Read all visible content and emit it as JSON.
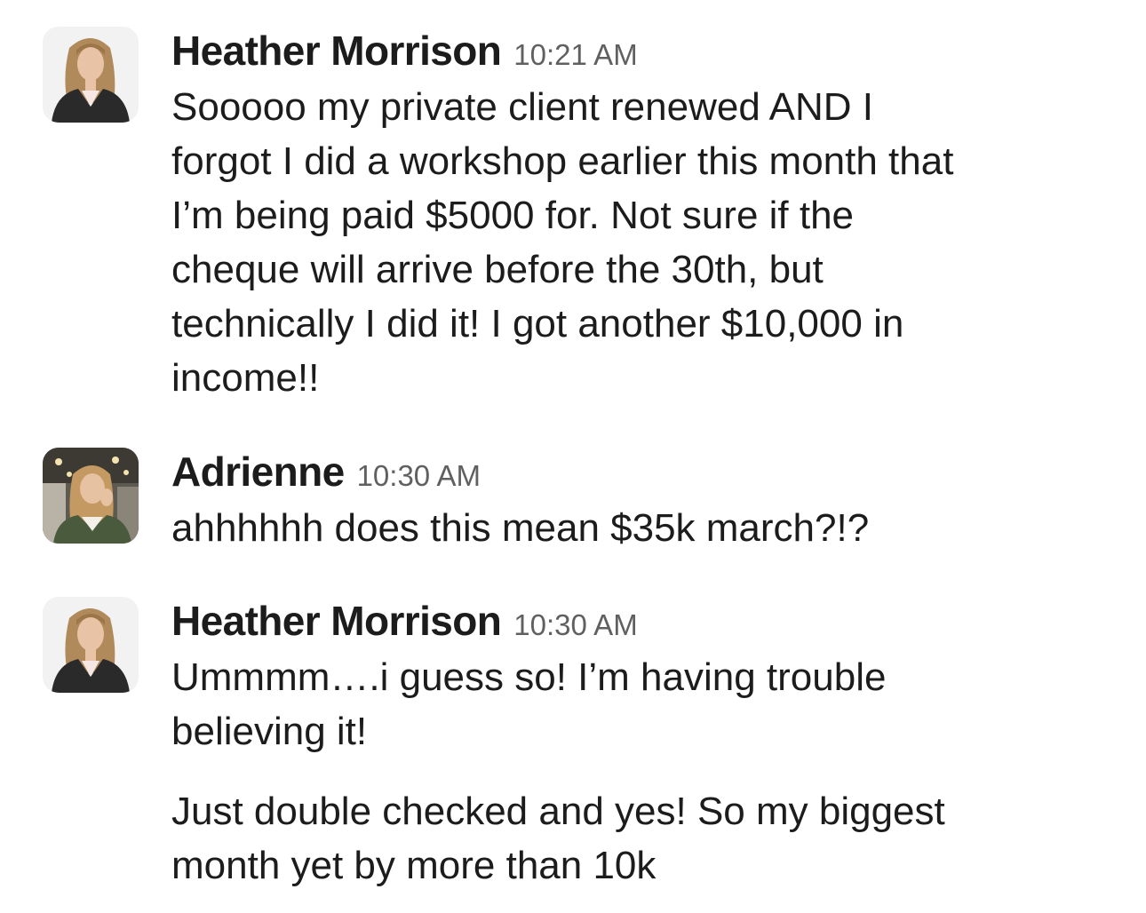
{
  "messages": [
    {
      "sender": "Heather Morrison",
      "timestamp": "10:21 AM",
      "avatar_icon": "avatar-heather",
      "paragraphs": [
        "Sooooo my private client renewed AND I\nforgot I did a workshop earlier this month that\nI’m being paid $5000 for. Not sure if the\ncheque will arrive before the 30th, but\ntechnically I did it! I got another $10,000 in\nincome!!"
      ]
    },
    {
      "sender": "Adrienne",
      "timestamp": "10:30 AM",
      "avatar_icon": "avatar-adrienne",
      "paragraphs": [
        "ahhhhhh does this mean $35k march?!?"
      ]
    },
    {
      "sender": "Heather Morrison",
      "timestamp": "10:30 AM",
      "avatar_icon": "avatar-heather",
      "paragraphs": [
        "Ummmm….i guess so! I’m having trouble\nbelieving it!",
        "Just double checked and yes! So my biggest\nmonth yet by more than 10k"
      ]
    }
  ]
}
